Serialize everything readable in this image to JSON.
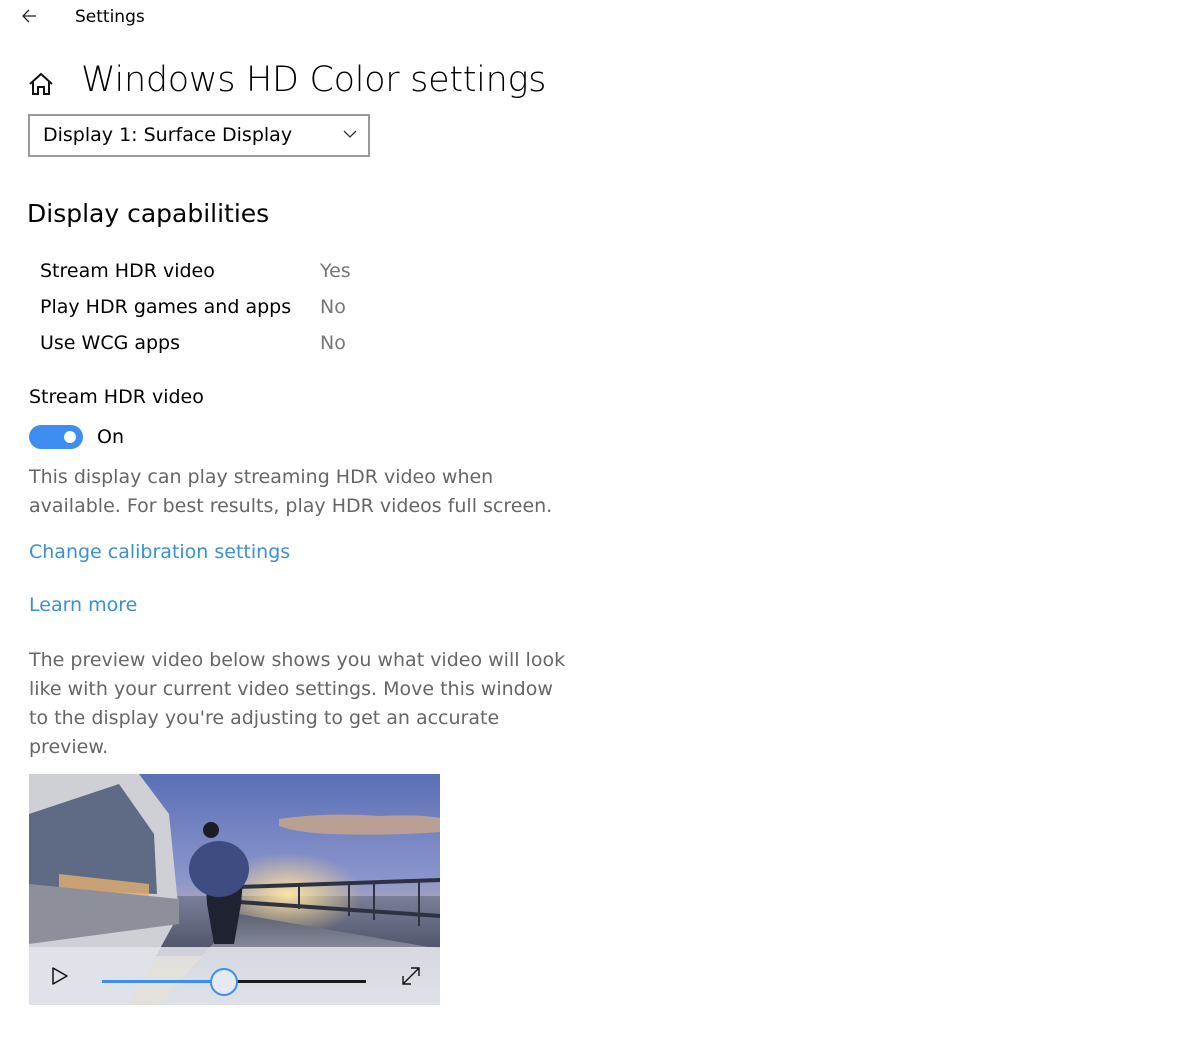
{
  "titlebar": {
    "back_icon": "back-arrow-icon",
    "title": "Settings"
  },
  "header": {
    "home_icon": "home-icon",
    "title": "Windows HD Color settings"
  },
  "display_select": {
    "selected": "Display 1: Surface Display",
    "icon": "chevron-down-icon"
  },
  "capabilities": {
    "heading": "Display capabilities",
    "rows": [
      {
        "label": "Stream HDR video",
        "value": "Yes"
      },
      {
        "label": "Play HDR games and apps",
        "value": "No"
      },
      {
        "label": "Use WCG apps",
        "value": "No"
      }
    ]
  },
  "stream_hdr": {
    "heading": "Stream HDR video",
    "toggle_on": true,
    "toggle_state_label": "On",
    "description_lines": [
      "This display can play streaming HDR video when",
      "available. For best results, play HDR videos full screen."
    ]
  },
  "links": {
    "calibration": "Change calibration settings",
    "learn_more": "Learn more"
  },
  "preview": {
    "description_lines": [
      "The preview video below shows you what video will look",
      "like with your current video settings. Move this window",
      "to the display you're adjusting to get an accurate",
      "preview."
    ],
    "video": {
      "play_icon": "play-icon",
      "fullscreen_icon": "fullscreen-icon",
      "progress_percent": 46
    }
  },
  "colors": {
    "accent": "#3d8ef0",
    "link": "#3a8fd6",
    "secondary_text": "#767676"
  }
}
